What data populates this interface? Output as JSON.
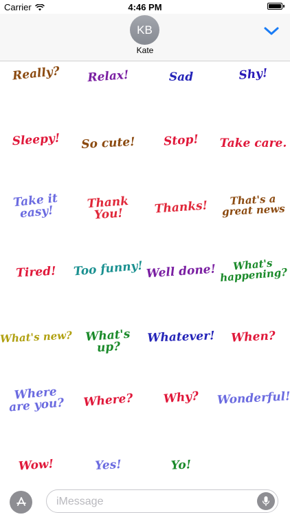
{
  "status_bar": {
    "carrier": "Carrier",
    "time": "4:46 PM"
  },
  "header": {
    "avatar_initials": "KB",
    "contact_name": "Kate",
    "accent_color": "#1a7cf5"
  },
  "stickers": [
    {
      "text": "Really?",
      "color": "#8b4a10"
    },
    {
      "text": "Relax!",
      "color": "#7a1fa2"
    },
    {
      "text": "Sad",
      "color": "#2424b8"
    },
    {
      "text": "Shy!",
      "color": "#2a1ab8"
    },
    {
      "text": "Sleepy!",
      "color": "#e0183a"
    },
    {
      "text": "So cute!",
      "color": "#8b4a10"
    },
    {
      "text": "Stop!",
      "color": "#e0183a"
    },
    {
      "text": "Take care.",
      "color": "#e0183a"
    },
    {
      "text": "Take it\neasy!",
      "color": "#6b6be0"
    },
    {
      "text": "Thank\nYou!",
      "color": "#e0283a"
    },
    {
      "text": "Thanks!",
      "color": "#e0283a"
    },
    {
      "text": "That's a\ngreat news",
      "color": "#8b4a10"
    },
    {
      "text": "Tired!",
      "color": "#e0183a"
    },
    {
      "text": "Too funny!",
      "color": "#1a9090"
    },
    {
      "text": "Well done!",
      "color": "#7a1fa2"
    },
    {
      "text": "What's\nhappening?",
      "color": "#1a8a2a"
    },
    {
      "text": "What's new?",
      "color": "#b0a010"
    },
    {
      "text": "What's up?",
      "color": "#1a8a2a"
    },
    {
      "text": "Whatever!",
      "color": "#2424b8"
    },
    {
      "text": "When?",
      "color": "#e0183a"
    },
    {
      "text": "Where\nare you?",
      "color": "#6b6be0"
    },
    {
      "text": "Where?",
      "color": "#e0183a"
    },
    {
      "text": "Why?",
      "color": "#e0183a"
    },
    {
      "text": "Wonderful!",
      "color": "#6b6be0"
    },
    {
      "text": "Wow!",
      "color": "#e0183a"
    },
    {
      "text": "Yes!",
      "color": "#6b6be0"
    },
    {
      "text": "Yo!",
      "color": "#1a8a2a"
    }
  ],
  "input_bar": {
    "placeholder": "iMessage",
    "value": "",
    "apps_icon": "app-store-icon",
    "mic_icon": "microphone-icon"
  }
}
